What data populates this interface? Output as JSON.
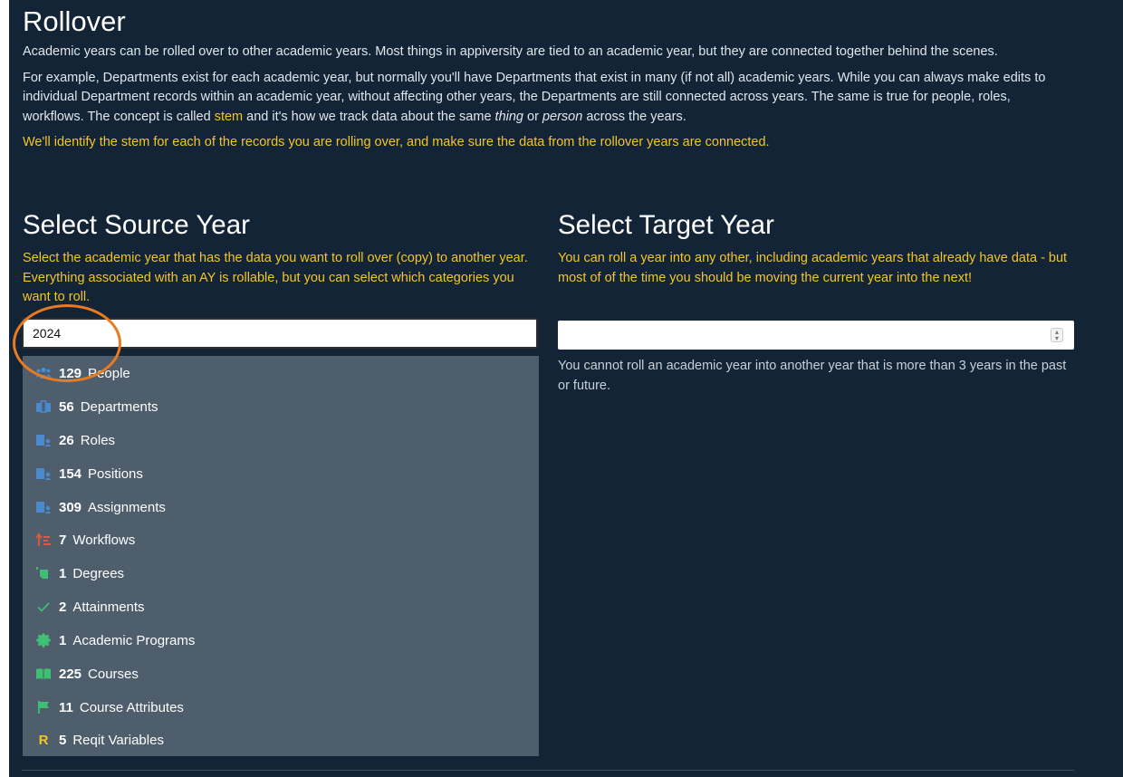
{
  "page": {
    "title": "Rollover",
    "intro": {
      "p1": "Academic years can be rolled over to other academic years. Most things in appiversity are tied to an academic year, but they are connected together behind the scenes.",
      "p2_before": "For example, Departments exist for each academic year, but normally you'll have Departments that exist in many (if not all) academic years. While you can always make edits to individual Department records within an academic year, without affecting other years, the Departments are still connected across years. The same is true for people, roles, workflows. The concept is called ",
      "p2_stem": "stem",
      "p2_mid": " and it's how we track data about the same ",
      "p2_thing": "thing",
      "p2_or": " or ",
      "p2_person": "person",
      "p2_end": " across the years.",
      "p3": "We'll identify the stem for each of the records you are rolling over, and make sure the data from the rollover years are connected."
    }
  },
  "source": {
    "heading": "Select Source Year",
    "description": "Select the academic year that has the data you want to roll over (copy) to another year. Everything associated with an AY is rollable, but you can select which categories you want to roll.",
    "input_value": "2024",
    "items": [
      {
        "count": "129",
        "label": "People",
        "icon": "people-icon",
        "color": "#4a8bd0"
      },
      {
        "count": "56",
        "label": "Departments",
        "icon": "departments-icon",
        "color": "#4a8bd0"
      },
      {
        "count": "26",
        "label": "Roles",
        "icon": "roles-icon",
        "color": "#4a8bd0"
      },
      {
        "count": "154",
        "label": "Positions",
        "icon": "positions-icon",
        "color": "#4a8bd0"
      },
      {
        "count": "309",
        "label": "Assignments",
        "icon": "assignments-icon",
        "color": "#4a8bd0"
      },
      {
        "count": "7",
        "label": "Workflows",
        "icon": "workflows-icon",
        "color": "#e25a3c"
      },
      {
        "count": "1",
        "label": "Degrees",
        "icon": "degrees-icon",
        "color": "#3fbf74"
      },
      {
        "count": "2",
        "label": "Attainments",
        "icon": "check-icon",
        "color": "#3fbf74"
      },
      {
        "count": "1",
        "label": "Academic Programs",
        "icon": "badge-icon",
        "color": "#3fbf74"
      },
      {
        "count": "225",
        "label": "Courses",
        "icon": "book-icon",
        "color": "#3fbf74"
      },
      {
        "count": "11",
        "label": "Course Attributes",
        "icon": "flag-icon",
        "color": "#3fbf74"
      },
      {
        "count": "5",
        "label": "Reqit Variables",
        "icon": "reqit-r-icon",
        "color": "#f3c623"
      }
    ]
  },
  "target": {
    "heading": "Select Target Year",
    "description": "You can roll a year into any other, including academic years that already have data - but most of of the time you should be moving the current year into the next!",
    "input_value": "",
    "hint": "You cannot roll an academic year into another year that is more than 3 years in the past or future."
  },
  "colors": {
    "background": "#132436",
    "accent": "#f3c623",
    "dropdown_bg": "#4e5e6c",
    "highlight_circle": "#ea7a1f"
  }
}
